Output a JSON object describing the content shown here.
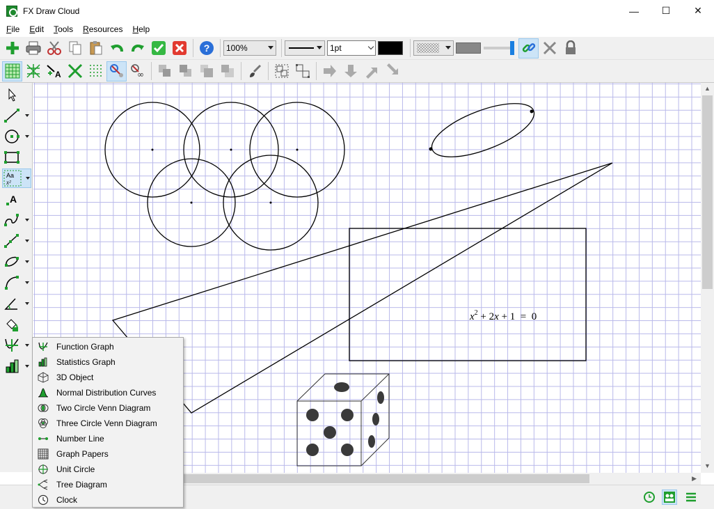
{
  "window": {
    "title": "FX Draw Cloud",
    "minimize": "—",
    "maximize": "☐",
    "close": "✕"
  },
  "menu": [
    {
      "label": "File",
      "key": "F",
      "rest": "ile"
    },
    {
      "label": "Edit",
      "key": "E",
      "rest": "dit"
    },
    {
      "label": "Tools",
      "key": "T",
      "rest": "ools"
    },
    {
      "label": "Resources",
      "key": "R",
      "rest": "esources"
    },
    {
      "label": "Help",
      "key": "H",
      "rest": "elp"
    }
  ],
  "toolbar": {
    "zoom": "100%",
    "line_weight": "1pt",
    "line_color": "#000000"
  },
  "canvas": {
    "equation": {
      "x": "x",
      "exp": "2",
      "rest1": " + 2",
      "x2": "x",
      "rest2": " + 1  =  0"
    }
  },
  "popup_menu": {
    "items": [
      {
        "label": "Function Graph",
        "icon": "function-graph-icon"
      },
      {
        "label": "Statistics Graph",
        "icon": "statistics-graph-icon"
      },
      {
        "label": "3D Object",
        "icon": "3d-object-icon"
      },
      {
        "label": "Normal Distribution Curves",
        "icon": "normal-distribution-icon"
      },
      {
        "label": "Two Circle Venn Diagram",
        "icon": "two-circle-venn-icon"
      },
      {
        "label": "Three Circle Venn Diagram",
        "icon": "three-circle-venn-icon"
      },
      {
        "label": "Number Line",
        "icon": "number-line-icon"
      },
      {
        "label": "Graph Papers",
        "icon": "graph-papers-icon"
      },
      {
        "label": "Unit Circle",
        "icon": "unit-circle-icon"
      },
      {
        "label": "Tree Diagram",
        "icon": "tree-diagram-icon"
      },
      {
        "label": "Clock",
        "icon": "clock-icon"
      }
    ]
  },
  "colors": {
    "accent_green": "#1e9e2e",
    "grid_line": "#b9b9ea",
    "active_bg": "#cce4f7"
  }
}
